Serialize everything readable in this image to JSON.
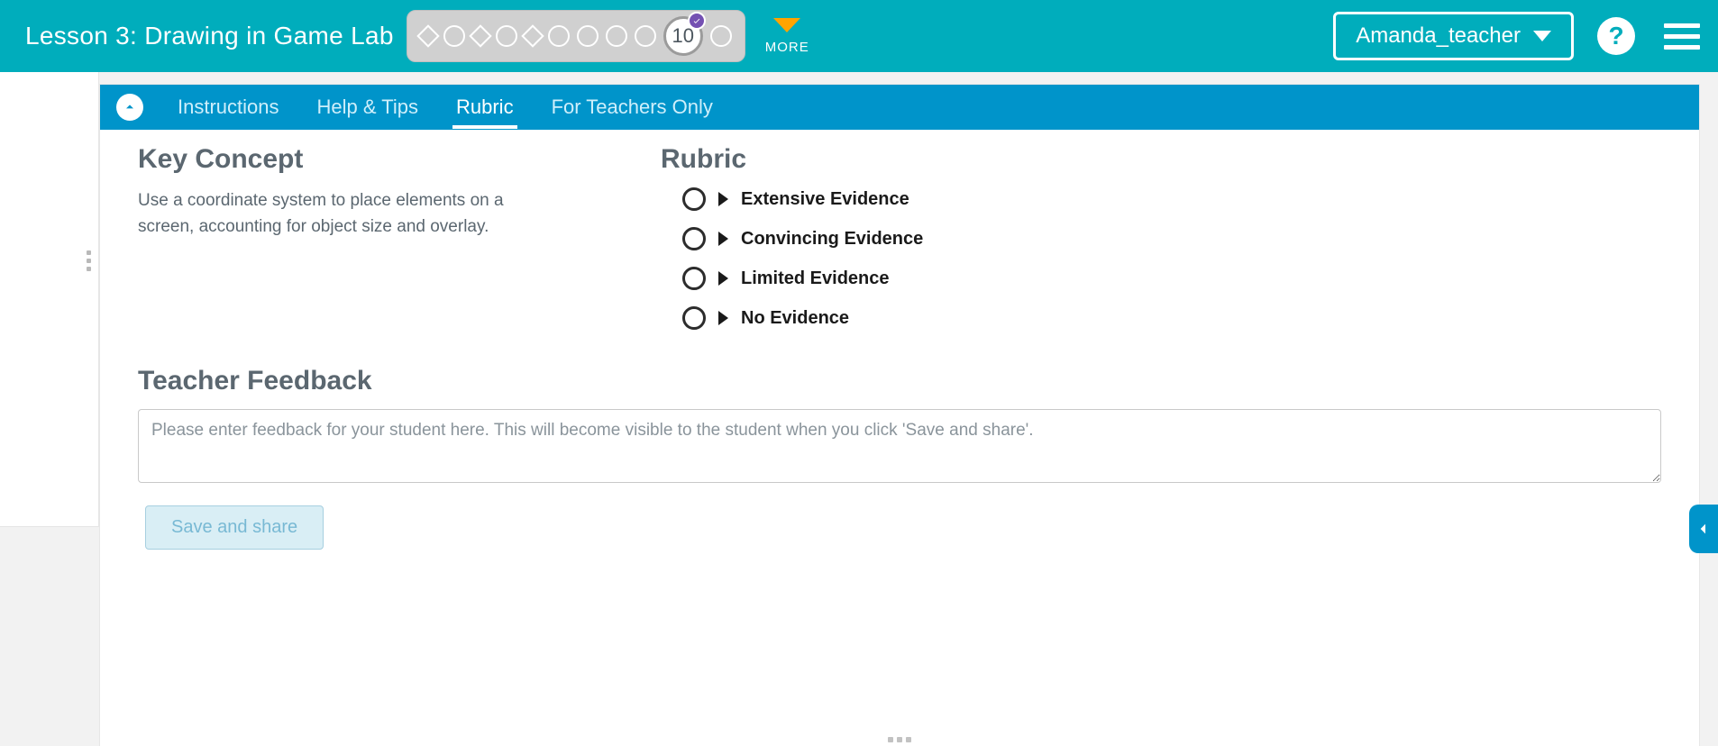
{
  "header": {
    "lesson_title": "Lesson 3: Drawing in Game Lab",
    "current_step_number": "10",
    "more_label": "MORE",
    "user_name": "Amanda_teacher",
    "help_glyph": "?"
  },
  "tabs": {
    "instructions": "Instructions",
    "help_tips": "Help & Tips",
    "rubric": "Rubric",
    "teachers": "For Teachers Only",
    "active": "rubric"
  },
  "key_concept": {
    "heading": "Key Concept",
    "text": "Use a coordinate system to place elements on a screen, accounting for object size and overlay."
  },
  "rubric": {
    "heading": "Rubric",
    "levels": [
      "Extensive Evidence",
      "Convincing Evidence",
      "Limited Evidence",
      "No Evidence"
    ]
  },
  "feedback": {
    "heading": "Teacher Feedback",
    "placeholder": "Please enter feedback for your student here. This will become visible to the student when you click 'Save and share'.",
    "save_label": "Save and share"
  }
}
